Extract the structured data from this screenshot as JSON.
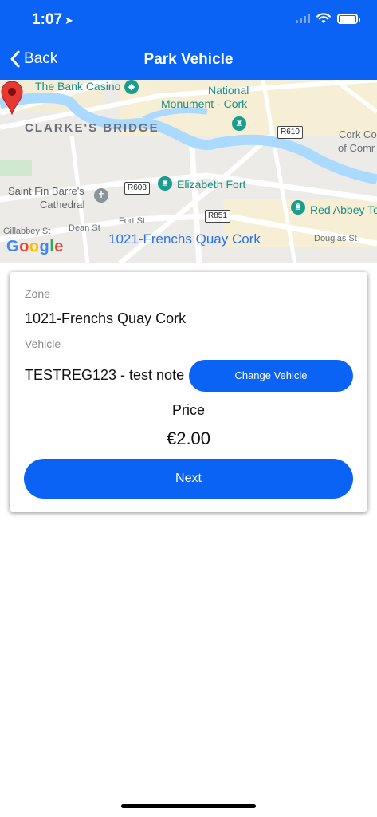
{
  "status_bar": {
    "time": "1:07",
    "location_icon": "location-arrow-icon",
    "icons": [
      "signal-icon",
      "wifi-icon",
      "battery-icon"
    ]
  },
  "nav": {
    "back_label": "Back",
    "title": "Park Vehicle",
    "bar_color": "#0b63f6"
  },
  "map": {
    "labels": {
      "bank_casino": "The Bank Casino",
      "national_line1": "National",
      "national_line2": "Monument - Cork",
      "clarkes_bridge": "CLARKE'S BRIDGE",
      "cork_line1": "Cork Co",
      "cork_line2": "of Comr",
      "elizabeth_fort": "Elizabeth Fort",
      "saint_fin_line1": "Saint Fin Barre's",
      "saint_fin_line2": "Cathedral",
      "red_abbey": "Red Abbey To",
      "dean_st": "Dean St",
      "fort_st": "Fort St",
      "gillabbey_st": "Gillabbey St",
      "douglas_st": "Douglas St",
      "zone_label": "1021-Frenchs Quay Cork"
    },
    "road_badges": {
      "r610": "R610",
      "r608": "R608",
      "r851": "R851"
    },
    "google_logo": [
      "G",
      "o",
      "o",
      "g",
      "l",
      "e"
    ],
    "marker_icon": "map-pin-icon"
  },
  "card": {
    "zone_label": "Zone",
    "zone_value": "1021-Frenchs Quay Cork",
    "vehicle_label": "Vehicle",
    "vehicle_value": "TESTREG123 - test note",
    "change_vehicle_label": "Change Vehicle",
    "price_label": "Price",
    "price_value": "€2.00",
    "next_label": "Next"
  }
}
